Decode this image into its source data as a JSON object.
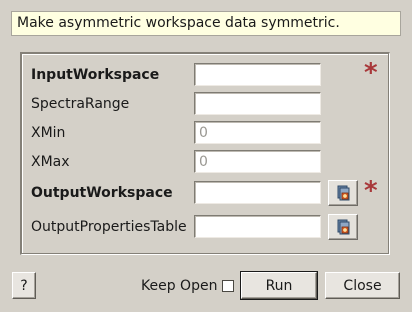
{
  "description": "Make asymmetric workspace data symmetric.",
  "fields": [
    {
      "label": "InputWorkspace",
      "value": "",
      "placeholder": "",
      "required": true
    },
    {
      "label": "SpectraRange",
      "value": "",
      "placeholder": ""
    },
    {
      "label": "XMin",
      "value": "",
      "placeholder": "0"
    },
    {
      "label": "XMax",
      "value": "",
      "placeholder": "0"
    },
    {
      "label": "OutputWorkspace",
      "value": "",
      "placeholder": "",
      "required": true,
      "browse_icon": "workspace-browse-icon"
    },
    {
      "label": "OutputPropertiesTable",
      "value": "",
      "placeholder": "",
      "browse_icon": "workspace-browse-icon"
    }
  ],
  "required_marker": "*",
  "footer": {
    "help_label": "?",
    "keep_open_label": "Keep Open",
    "keep_open_checked": false,
    "run_label": "Run",
    "close_label": "Close"
  },
  "colors": {
    "background": "#d4d0c8",
    "description_background": "#ffffe1",
    "required_star": "#a8383a"
  }
}
